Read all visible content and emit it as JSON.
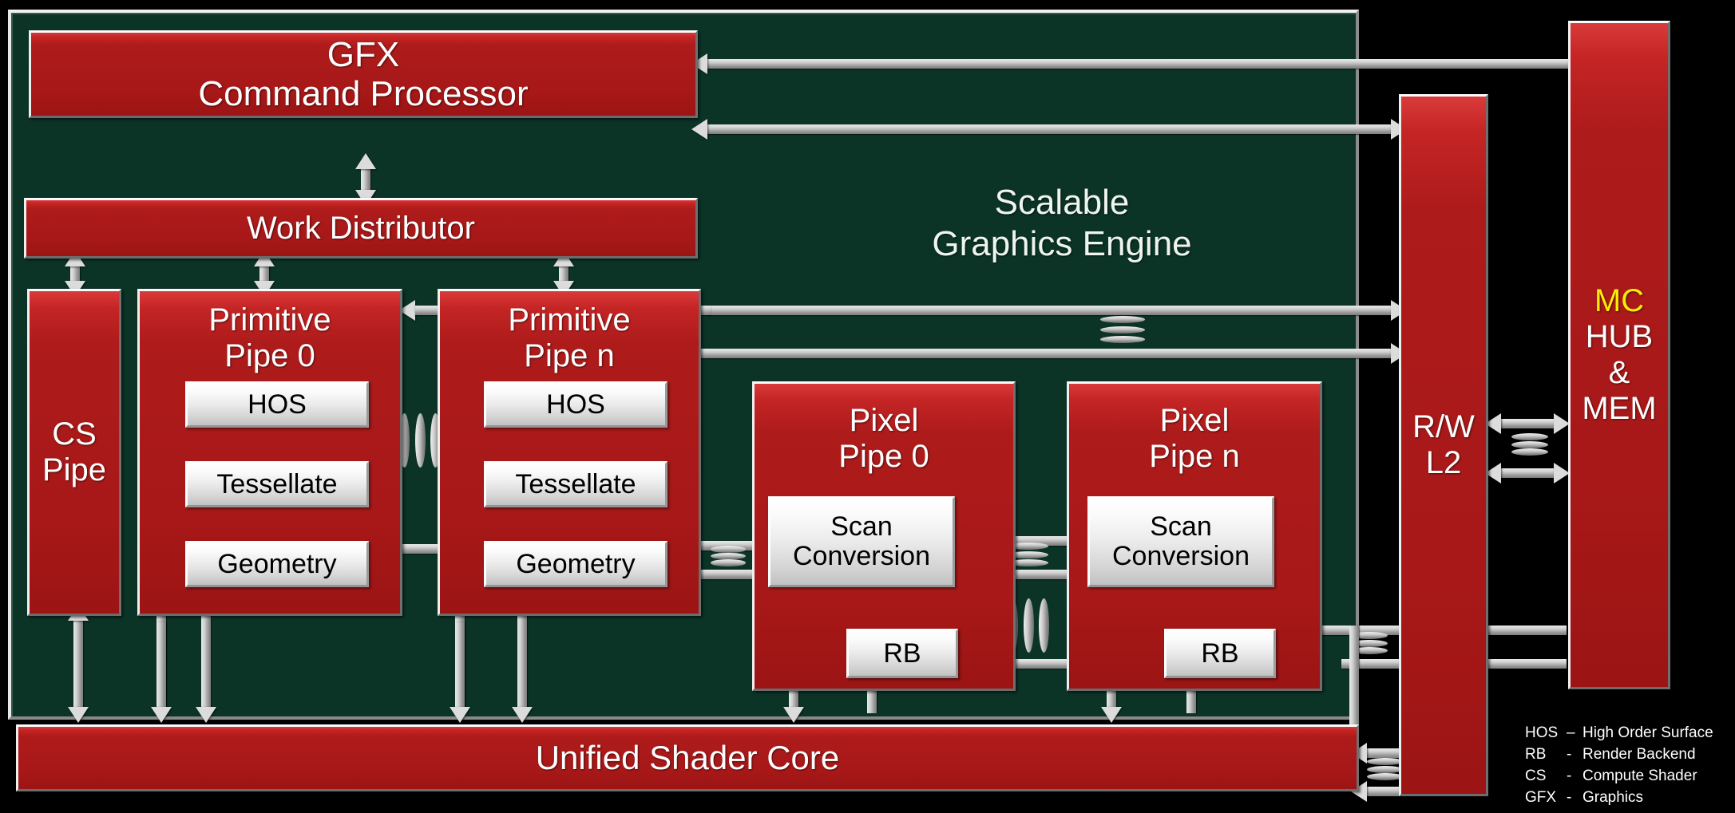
{
  "diagram": {
    "title": "Scalable Graphics Engine",
    "engine_label_line1": "Scalable",
    "engine_label_line2": "Graphics Engine",
    "colors": {
      "block_red": "#ad1a1a",
      "engine_green": "#0b3427",
      "inner_gray": "#ececec",
      "background": "#000000",
      "mc_accent_yellow": "#ffec00",
      "connector_silver": "#cfcfcf"
    }
  },
  "blocks": {
    "gfx_command_processor": {
      "line1": "GFX",
      "line2": "Command Processor"
    },
    "work_distributor": {
      "label": "Work Distributor"
    },
    "cs_pipe": {
      "line1": "CS",
      "line2": "Pipe"
    },
    "primitive_pipe_0": {
      "line1": "Primitive",
      "line2": "Pipe 0",
      "stages": [
        "HOS",
        "Tessellate",
        "Geometry"
      ]
    },
    "primitive_pipe_n": {
      "line1": "Primitive",
      "line2": "Pipe n",
      "stages": [
        "HOS",
        "Tessellate",
        "Geometry"
      ]
    },
    "pixel_pipe_0": {
      "line1": "Pixel",
      "line2": "Pipe 0",
      "scan_line1": "Scan",
      "scan_line2": "Conversion",
      "rb": "RB"
    },
    "pixel_pipe_n": {
      "line1": "Pixel",
      "line2": "Pipe n",
      "scan_line1": "Scan",
      "scan_line2": "Conversion",
      "rb": "RB"
    },
    "unified_shader_core": {
      "label": "Unified Shader Core"
    },
    "rw_l2": {
      "line1": "R/W",
      "line2": "L2"
    },
    "mc_hub_mem": {
      "line1": "MC",
      "line2": "HUB",
      "line3": "&",
      "line4": "MEM"
    }
  },
  "legend": {
    "items": [
      {
        "key": "HOS",
        "dash": "–",
        "text": "High Order Surface"
      },
      {
        "key": "RB",
        "dash": "-",
        "text": "Render Backend"
      },
      {
        "key": "CS",
        "dash": "-",
        "text": "Compute Shader"
      },
      {
        "key": "GFX",
        "dash": "-",
        "text": "Graphics"
      }
    ]
  }
}
